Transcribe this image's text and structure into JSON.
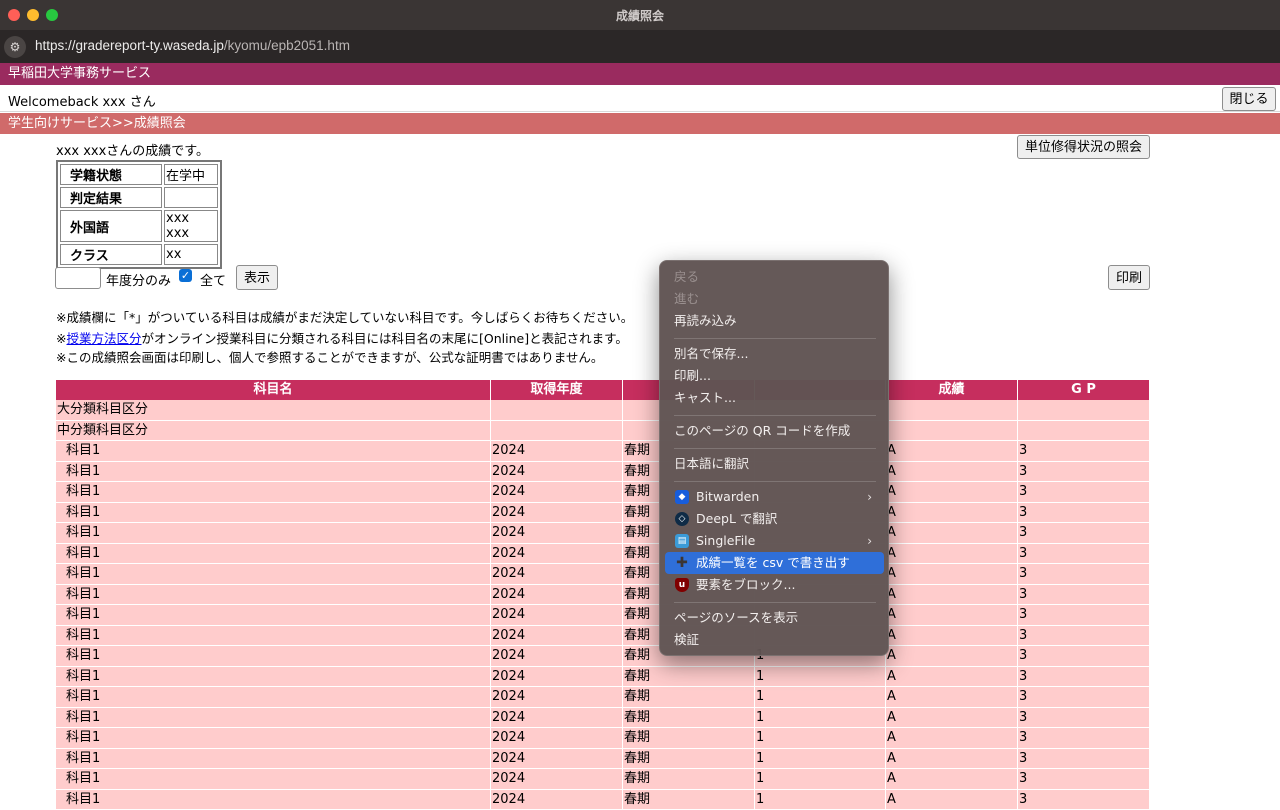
{
  "window": {
    "title": "成績照会"
  },
  "browser": {
    "url_host": "https://gradereport-ty.waseda.jp",
    "url_path": "/kyomu/epb2051.htm"
  },
  "header": {
    "bar_title": "早稲田大学事務サービス",
    "welcome": "Welcomeback xxx さん",
    "close_label": "閉じる",
    "breadcrumb": "学生向けサービス>>成績照会"
  },
  "main": {
    "intro": "xxx xxxさんの成績です。",
    "credit_button": "単位修得状況の照会",
    "status_table": [
      {
        "key": "学籍状態",
        "value": "在学中"
      },
      {
        "key": "判定結果",
        "value": ""
      },
      {
        "key": "外国語",
        "value": "xxx xxx"
      },
      {
        "key": "クラス",
        "value": "xx"
      }
    ],
    "filter": {
      "year_value": "",
      "year_label": "年度分のみ",
      "all_label": "全て",
      "all_checked": true,
      "show_label": "表示"
    },
    "print_label": "印刷",
    "notes": {
      "note1": "※成績欄に「*」がついている科目は成績がまだ決定していない科目です。今しばらくお待ちください。",
      "note2_prefix": "※",
      "note2_link": "授業方法区分",
      "note2_rest": "がオンライン授業科目に分類される科目には科目名の末尾に[Online]と表記されます。",
      "note3": "※この成績照会画面は印刷し、個人で参照することができますが、公式な証明書ではありません。"
    }
  },
  "grade_table": {
    "headers": [
      "科目名",
      "取得年度",
      "",
      "",
      "成績",
      "G P"
    ],
    "category_rows": [
      {
        "name": "大分類科目区分"
      },
      {
        "name": "中分類科目区分"
      }
    ],
    "rows": [
      {
        "name": "科目1",
        "year": "2024",
        "term": "春期",
        "credit": "",
        "grade": "A",
        "gp": "3"
      },
      {
        "name": "科目1",
        "year": "2024",
        "term": "春期",
        "credit": "",
        "grade": "A",
        "gp": "3"
      },
      {
        "name": "科目1",
        "year": "2024",
        "term": "春期",
        "credit": "",
        "grade": "A",
        "gp": "3"
      },
      {
        "name": "科目1",
        "year": "2024",
        "term": "春期",
        "credit": "",
        "grade": "A",
        "gp": "3"
      },
      {
        "name": "科目1",
        "year": "2024",
        "term": "春期",
        "credit": "",
        "grade": "A",
        "gp": "3"
      },
      {
        "name": "科目1",
        "year": "2024",
        "term": "春期",
        "credit": "",
        "grade": "A",
        "gp": "3"
      },
      {
        "name": "科目1",
        "year": "2024",
        "term": "春期",
        "credit": "",
        "grade": "A",
        "gp": "3"
      },
      {
        "name": "科目1",
        "year": "2024",
        "term": "春期",
        "credit": "",
        "grade": "A",
        "gp": "3"
      },
      {
        "name": "科目1",
        "year": "2024",
        "term": "春期",
        "credit": "",
        "grade": "A",
        "gp": "3"
      },
      {
        "name": "科目1",
        "year": "2024",
        "term": "春期",
        "credit": "",
        "grade": "A",
        "gp": "3"
      },
      {
        "name": "科目1",
        "year": "2024",
        "term": "春期",
        "credit": "1",
        "grade": "A",
        "gp": "3"
      },
      {
        "name": "科目1",
        "year": "2024",
        "term": "春期",
        "credit": "1",
        "grade": "A",
        "gp": "3"
      },
      {
        "name": "科目1",
        "year": "2024",
        "term": "春期",
        "credit": "1",
        "grade": "A",
        "gp": "3"
      },
      {
        "name": "科目1",
        "year": "2024",
        "term": "春期",
        "credit": "1",
        "grade": "A",
        "gp": "3"
      },
      {
        "name": "科目1",
        "year": "2024",
        "term": "春期",
        "credit": "1",
        "grade": "A",
        "gp": "3"
      },
      {
        "name": "科目1",
        "year": "2024",
        "term": "春期",
        "credit": "1",
        "grade": "A",
        "gp": "3"
      },
      {
        "name": "科目1",
        "year": "2024",
        "term": "春期",
        "credit": "1",
        "grade": "A",
        "gp": "3"
      },
      {
        "name": "科目1",
        "year": "2024",
        "term": "春期",
        "credit": "1",
        "grade": "A",
        "gp": "3"
      }
    ]
  },
  "context_menu": {
    "back": "戻る",
    "forward": "進む",
    "reload": "再読み込み",
    "save_as": "別名で保存...",
    "print": "印刷...",
    "cast": "キャスト...",
    "qr": "このページの QR コードを作成",
    "translate": "日本語に翻訳",
    "bitwarden": "Bitwarden",
    "deepl": "DeepL で翻訳",
    "singlefile": "SingleFile",
    "csv_export": "成績一覧を csv で書き出す",
    "block": "要素をブロック...",
    "view_source": "ページのソースを表示",
    "inspect": "検証",
    "icons": {
      "bitwarden": "bitwarden-shield-icon",
      "deepl": "deepl-icon",
      "singlefile": "singlefile-icon",
      "csv_export": "puzzle-extension-icon",
      "block": "ublock-icon"
    }
  },
  "colors": {
    "bar_title": "#9a2b5f",
    "breadcrumb": "#d06a6a",
    "table_header": "#c62e5e",
    "table_row": "#ffcccc",
    "menu_highlight": "#2f6fd9"
  }
}
